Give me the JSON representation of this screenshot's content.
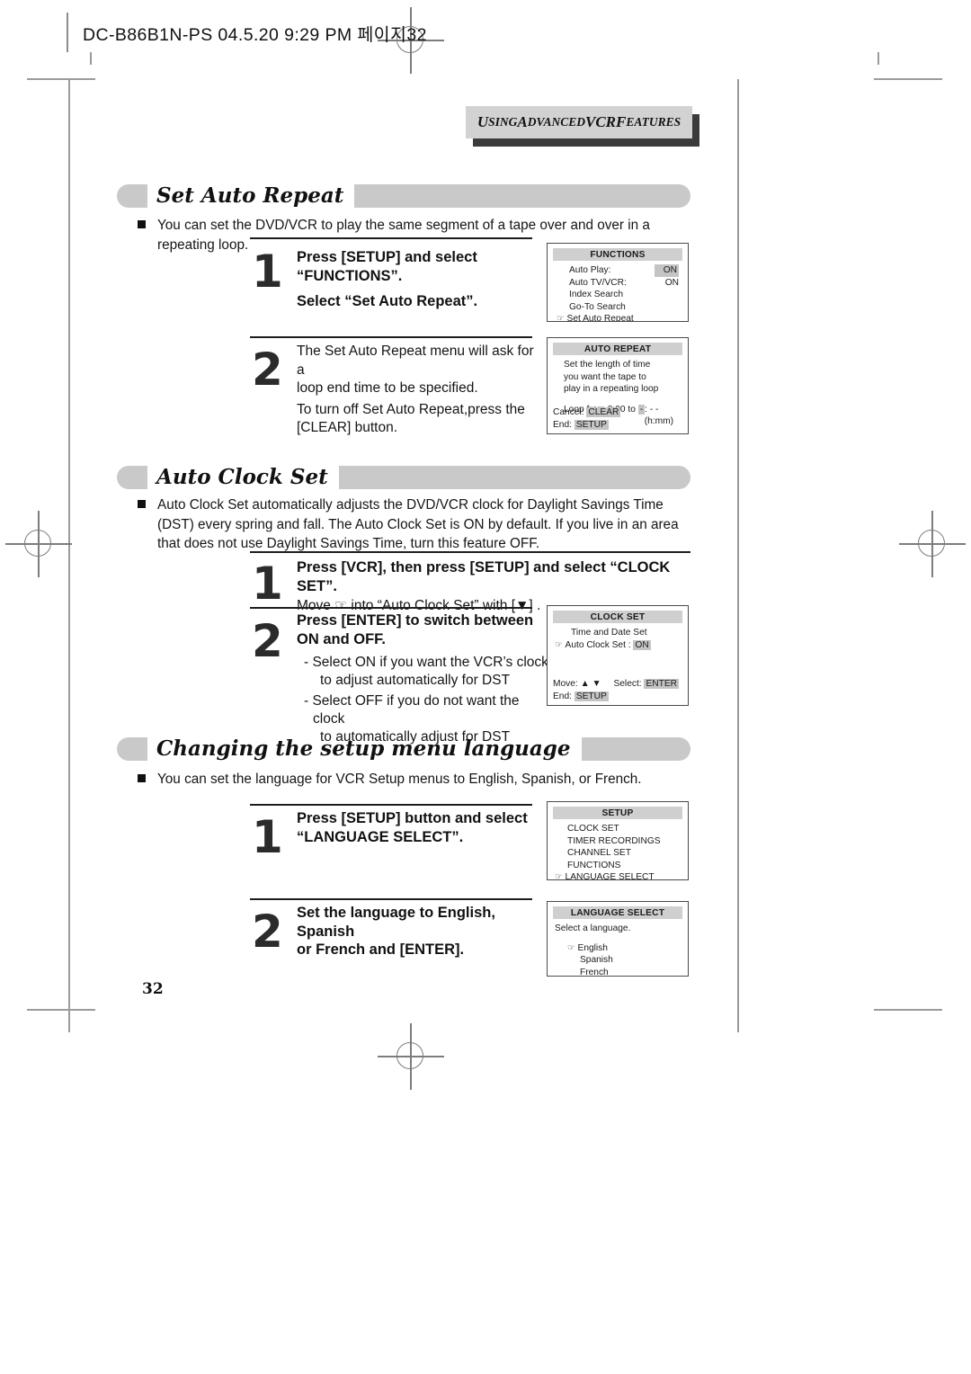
{
  "printer_slug": "DC-B86B1N-PS  04.5.20 9:29 PM  페이지32",
  "running_head": "USING ADVANCED VCR FEATURES",
  "folio": "32",
  "sections": [
    {
      "title": "Set Auto Repeat",
      "intro": "You can set the DVD/VCR to play the same segment of a tape over and over in a repeating loop.",
      "steps": [
        {
          "number": "1",
          "heading_line1": "Press [SETUP] and select",
          "heading_line2": "“FUNCTIONS”.",
          "sub_bold": "Select “Set Auto Repeat”."
        },
        {
          "number": "2",
          "body_line1": "The Set Auto Repeat menu will ask for a",
          "body_line2": "loop end time to be specified.",
          "body_line3": "To turn off Set Auto Repeat,press the",
          "body_line4": "[CLEAR] button."
        }
      ]
    },
    {
      "title": "Auto Clock Set",
      "intro": "Auto Clock Set automatically adjusts the DVD/VCR clock for Daylight Savings Time (DST) every spring and fall. The Auto Clock Set is ON by default. If you live in an area that does not use Daylight Savings Time, turn this feature OFF.",
      "steps": [
        {
          "number": "1",
          "heading_line1": "Press [VCR], then press [SETUP] and select “CLOCK SET”.",
          "sub_line": "Move ☞ into “Auto Clock Set” with [▼] ."
        },
        {
          "number": "2",
          "heading_line1": "Press [ENTER] to switch between",
          "heading_line2": "ON and OFF.",
          "dashes": [
            "- Select ON if you want the VCR’s clock",
            "to adjust automatically for DST",
            "- Select OFF if you do not want the clock",
            "to automatically adjust for DST"
          ]
        }
      ]
    },
    {
      "title": "Changing the setup menu language",
      "intro": "You can set the language for VCR Setup menus to English, Spanish, or French.",
      "steps": [
        {
          "number": "1",
          "heading_line1": "Press [SETUP] button and select",
          "heading_line2": "“LANGUAGE SELECT”."
        },
        {
          "number": "2",
          "heading_line1": "Set the language to English, Spanish",
          "heading_line2": "or French and [ENTER]."
        }
      ]
    }
  ],
  "osd_screens": {
    "functions": {
      "title": "FUNCTIONS",
      "rows": [
        {
          "label": "Auto Play:",
          "value": "ON",
          "highlight": true
        },
        {
          "label": "Auto TV/VCR:",
          "value": "ON",
          "highlight": false
        }
      ],
      "items": [
        {
          "label": "Index Search",
          "pointer": false
        },
        {
          "label": "Go-To Search",
          "pointer": false
        },
        {
          "label": "Set Auto Repeat",
          "pointer": true
        }
      ]
    },
    "auto_repeat": {
      "title": "AUTO REPEAT",
      "line1": "Set the length of time",
      "line2": "you want the tape to",
      "line3": "play in a repeating loop",
      "loop_prefix": "Loop from 0:00 to",
      "loop_hour": "-",
      "loop_suffix": ": - -",
      "units": "(h:mm)",
      "cancel_label": "Cancel:",
      "cancel_key": "CLEAR",
      "end_label": "End:",
      "end_key": "SETUP"
    },
    "clock_set": {
      "title": "CLOCK SET",
      "item1": "Time and Date Set",
      "item2_label": "Auto Clock Set :",
      "item2_value": "ON",
      "move_label": "Move:",
      "move_keys": "▲ ▼",
      "select_label": "Select:",
      "select_key": "ENTER",
      "end_label": "End:",
      "end_key": "SETUP"
    },
    "setup": {
      "title": "SETUP",
      "items": [
        {
          "label": "CLOCK SET",
          "pointer": false
        },
        {
          "label": "TIMER RECORDINGS",
          "pointer": false
        },
        {
          "label": "CHANNEL SET",
          "pointer": false
        },
        {
          "label": "FUNCTIONS",
          "pointer": false
        },
        {
          "label": "LANGUAGE SELECT",
          "pointer": true
        }
      ]
    },
    "language_select": {
      "title": "LANGUAGE SELECT",
      "prompt": "Select a language.",
      "items": [
        {
          "label": "English",
          "pointer": true
        },
        {
          "label": "Spanish",
          "pointer": false
        },
        {
          "label": "French",
          "pointer": false
        }
      ]
    }
  }
}
